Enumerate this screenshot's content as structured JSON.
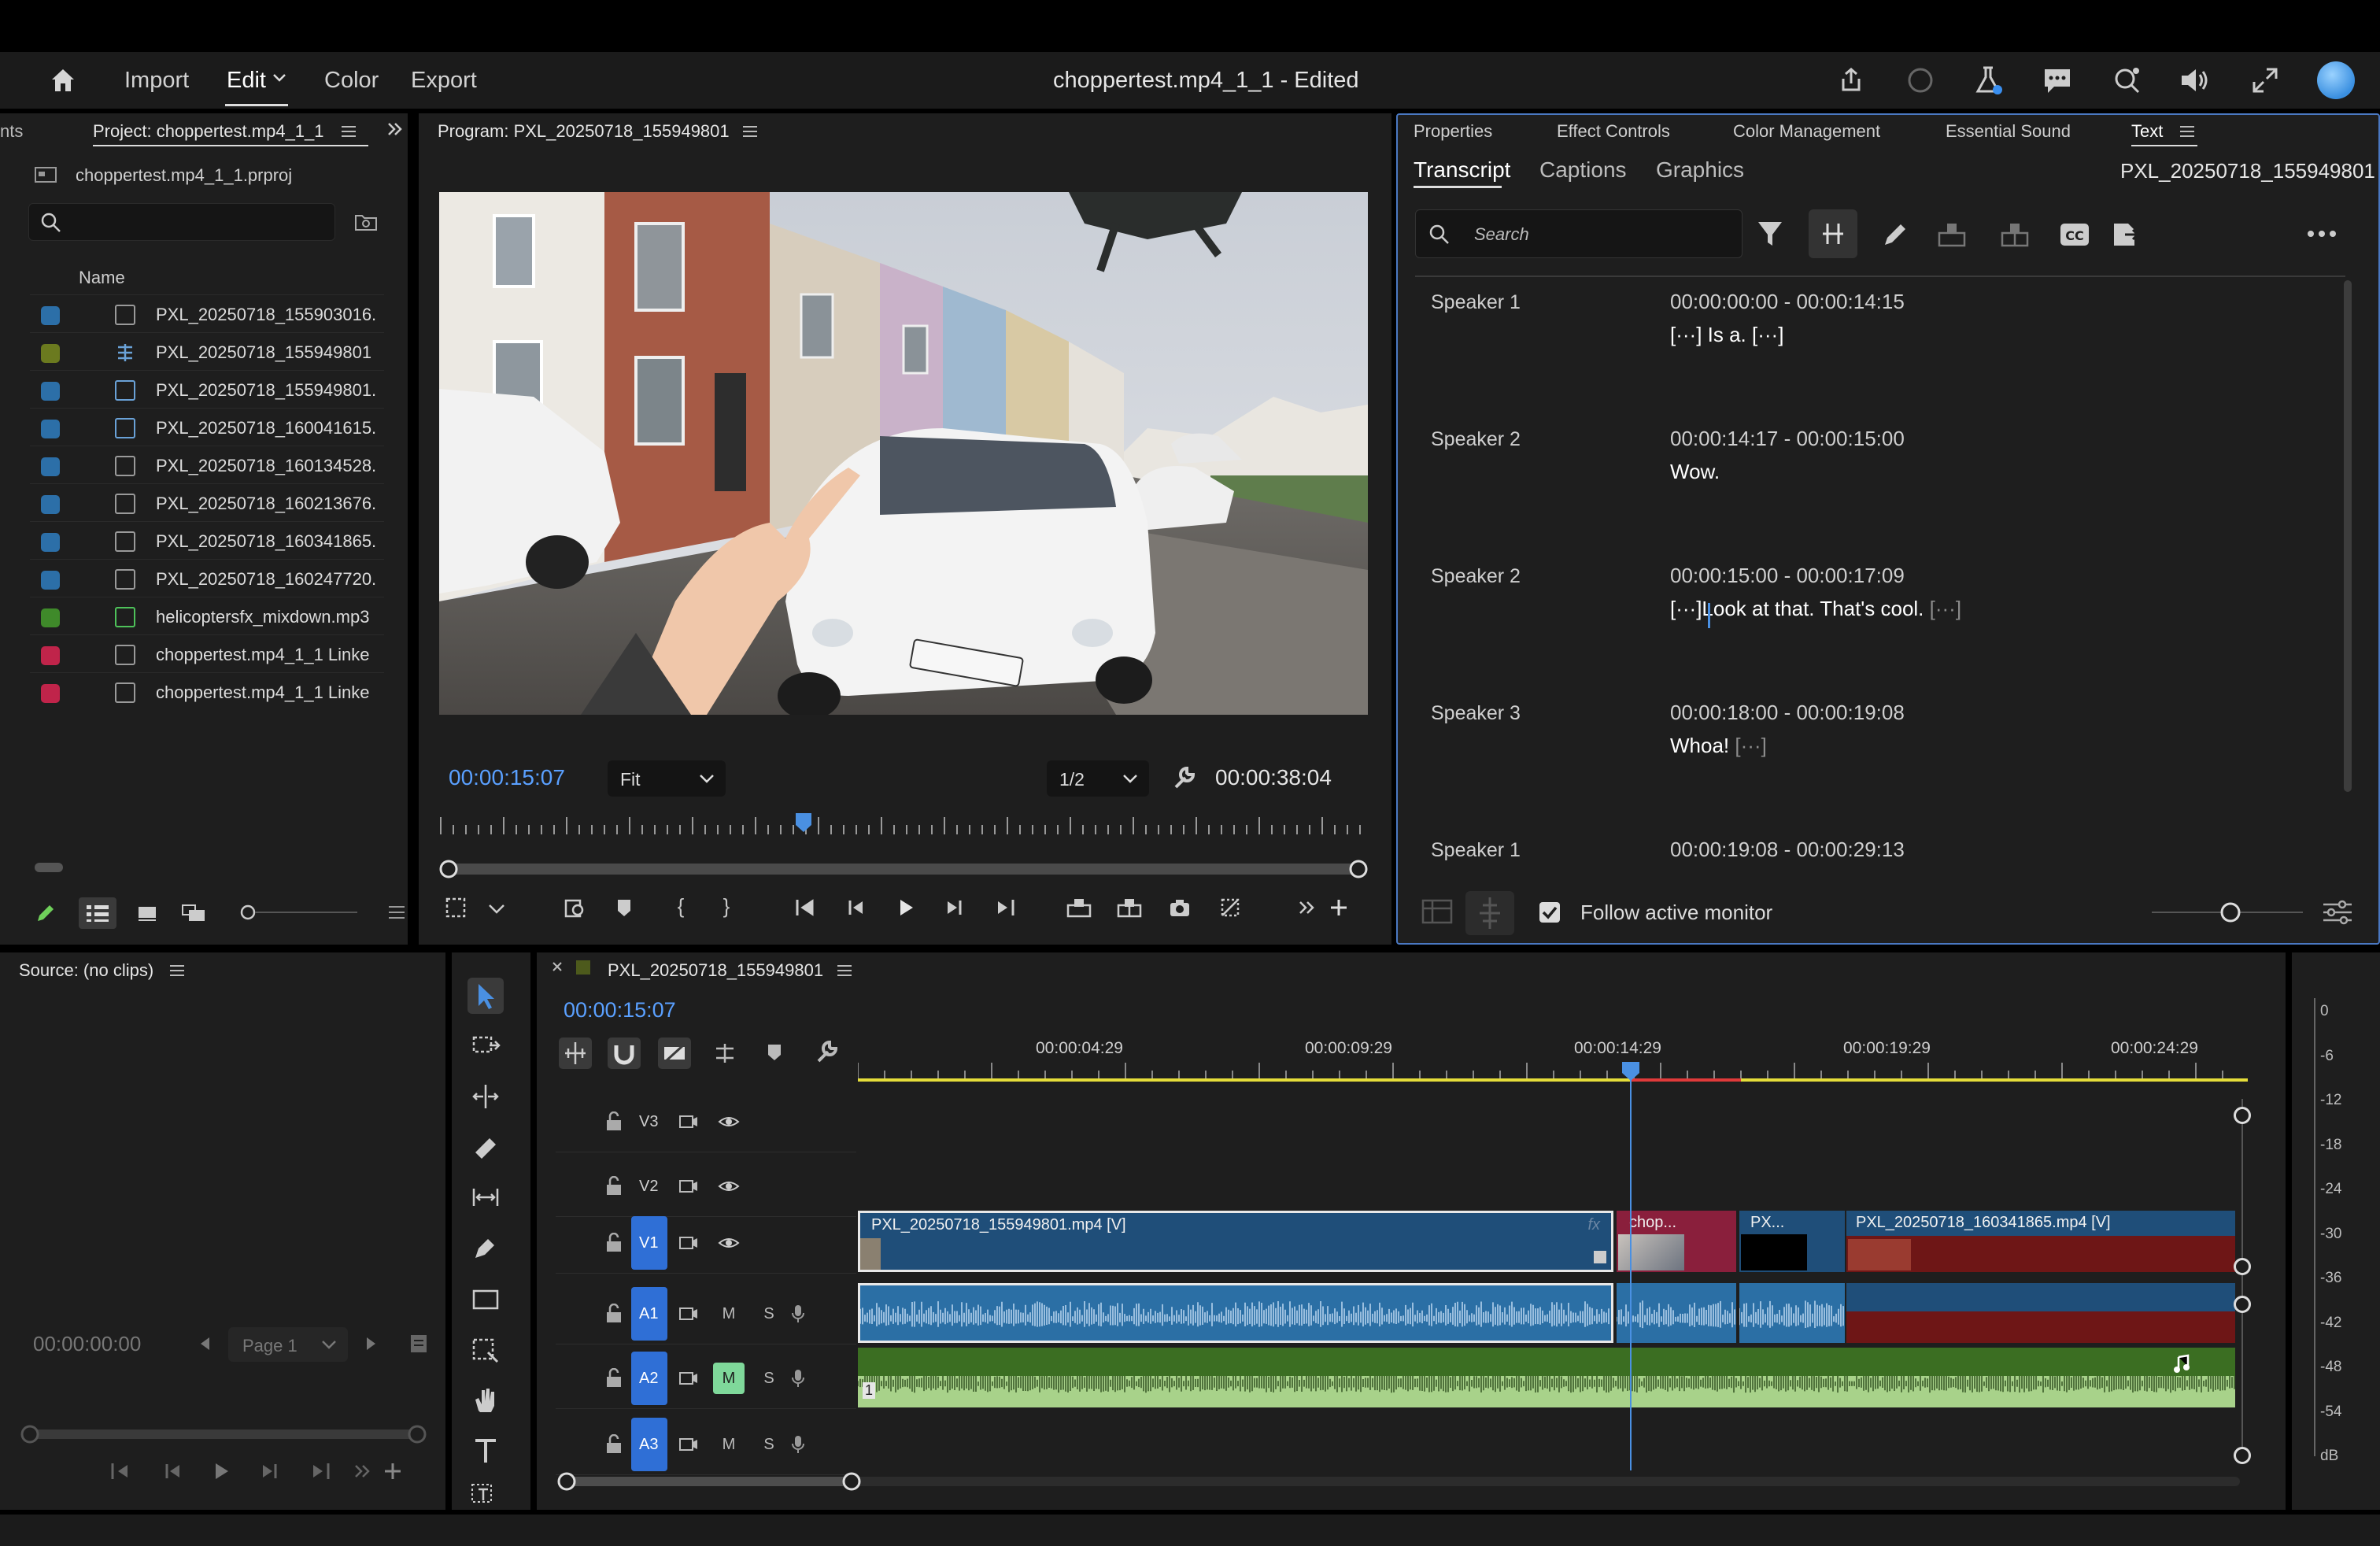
{
  "menubar": {
    "items": [
      "Import",
      "Edit",
      "Color",
      "Export"
    ],
    "active": "Edit",
    "title": "choppertest.mp4_1_1 - Edited",
    "right_icons": [
      "share-icon",
      "progress-circle-icon",
      "beta-flask-icon",
      "feedback-icon",
      "search-help-icon",
      "volume-icon",
      "fullscreen-icon",
      "creative-cloud-icon"
    ]
  },
  "project": {
    "left_tab_clip": "nts",
    "tab": "Project: choppertest.mp4_1_1",
    "file": "choppertest.mp4_1_1.prproj",
    "column": "Name",
    "items": [
      {
        "name": "PXL_20250718_155903016.",
        "chip": "#2c6fa8",
        "kind": "video"
      },
      {
        "name": "PXL_20250718_155949801",
        "chip": "#6b7a1f",
        "kind": "sequence"
      },
      {
        "name": "PXL_20250718_155949801.",
        "chip": "#2c6fa8",
        "kind": "multicam"
      },
      {
        "name": "PXL_20250718_160041615.",
        "chip": "#2c6fa8",
        "kind": "multicam"
      },
      {
        "name": "PXL_20250718_160134528.",
        "chip": "#2c6fa8",
        "kind": "video"
      },
      {
        "name": "PXL_20250718_160213676.",
        "chip": "#2c6fa8",
        "kind": "video"
      },
      {
        "name": "PXL_20250718_160341865.",
        "chip": "#2c6fa8",
        "kind": "video"
      },
      {
        "name": "PXL_20250718_160247720.",
        "chip": "#2c6fa8",
        "kind": "video"
      },
      {
        "name": "helicoptersfx_mixdown.mp3",
        "chip": "#3f8a2a",
        "kind": "audio"
      },
      {
        "name": "choppertest.mp4_1_1 Linke",
        "chip": "#c0244a",
        "kind": "linked"
      },
      {
        "name": "choppertest.mp4_1_1 Linke",
        "chip": "#c0244a",
        "kind": "linked"
      }
    ]
  },
  "program": {
    "title": "Program: PXL_20250718_155949801",
    "timecode": "00:00:15:07",
    "fit": "Fit",
    "resolution": "1/2",
    "duration": "00:00:38:04",
    "playhead_fraction": 0.39
  },
  "text_panel": {
    "tabs": [
      "Properties",
      "Effect Controls",
      "Color Management",
      "Essential Sound",
      "Text"
    ],
    "active_tab": "Text",
    "subtabs": [
      "Transcript",
      "Captions",
      "Graphics"
    ],
    "active_subtab": "Transcript",
    "clip_name": "PXL_20250718_155949801",
    "search_placeholder": "Search",
    "follow_label": "Follow active monitor",
    "follow_checked": true,
    "segments": [
      {
        "speaker": "Speaker 1",
        "time": "00:00:00:00 - 00:00:14:15",
        "pre": "[···]",
        "text": " Is a. ",
        "post": "[···]"
      },
      {
        "speaker": "Speaker 2",
        "time": "00:00:14:17 - 00:00:15:00",
        "pre": "",
        "text": "Wow.",
        "post": ""
      },
      {
        "speaker": "Speaker 2",
        "time": "00:00:15:00 - 00:00:17:09",
        "pre": "[···]",
        "text": "Look at that. That's cool. ",
        "post": "[···]"
      },
      {
        "speaker": "Speaker 3",
        "time": "00:00:18:00 - 00:00:19:08",
        "pre": "",
        "text": "Whoa! ",
        "post": "[···]"
      },
      {
        "speaker": "Speaker 1",
        "time": "00:00:19:08 - 00:00:29:13",
        "pre": "",
        "text": "",
        "post": ""
      }
    ]
  },
  "source": {
    "title": "Source: (no clips)",
    "timecode": "00:00:00:00",
    "page": "Page 1"
  },
  "timeline": {
    "tab": "PXL_20250718_155949801",
    "timecode": "00:00:15:07",
    "ruler": [
      "00:00:04:29",
      "00:00:09:29",
      "00:00:14:29",
      "00:00:19:29",
      "00:00:24:29"
    ],
    "tracks": {
      "v3": "V3",
      "v2": "V2",
      "v1": "V1",
      "a1": "A1",
      "a2": "A2",
      "a3": "A3",
      "mute": "M",
      "solo": "S"
    },
    "clips": {
      "v1a": "PXL_20250718_155949801.mp4 [V]",
      "v1b": "chop...",
      "v1c": "PX...",
      "v1d": "PXL_20250718_160341865.mp4 [V]",
      "fx": "fx",
      "a2_marker": "1"
    }
  },
  "meter": {
    "labels": [
      "0",
      "-6",
      "-12",
      "-18",
      "-24",
      "-30",
      "-36",
      "-42",
      "-48",
      "-54",
      "dB"
    ]
  },
  "colors": {
    "accent_blue": "#4a90e2",
    "timecode_blue": "#5aa0ff",
    "video_clip": "#1f4e79",
    "audio_clip": "#2b6fa5",
    "linked_clip": "#8a1f3c",
    "music_clip": "#a8d28a",
    "panel_bg": "#1e1e1e"
  }
}
